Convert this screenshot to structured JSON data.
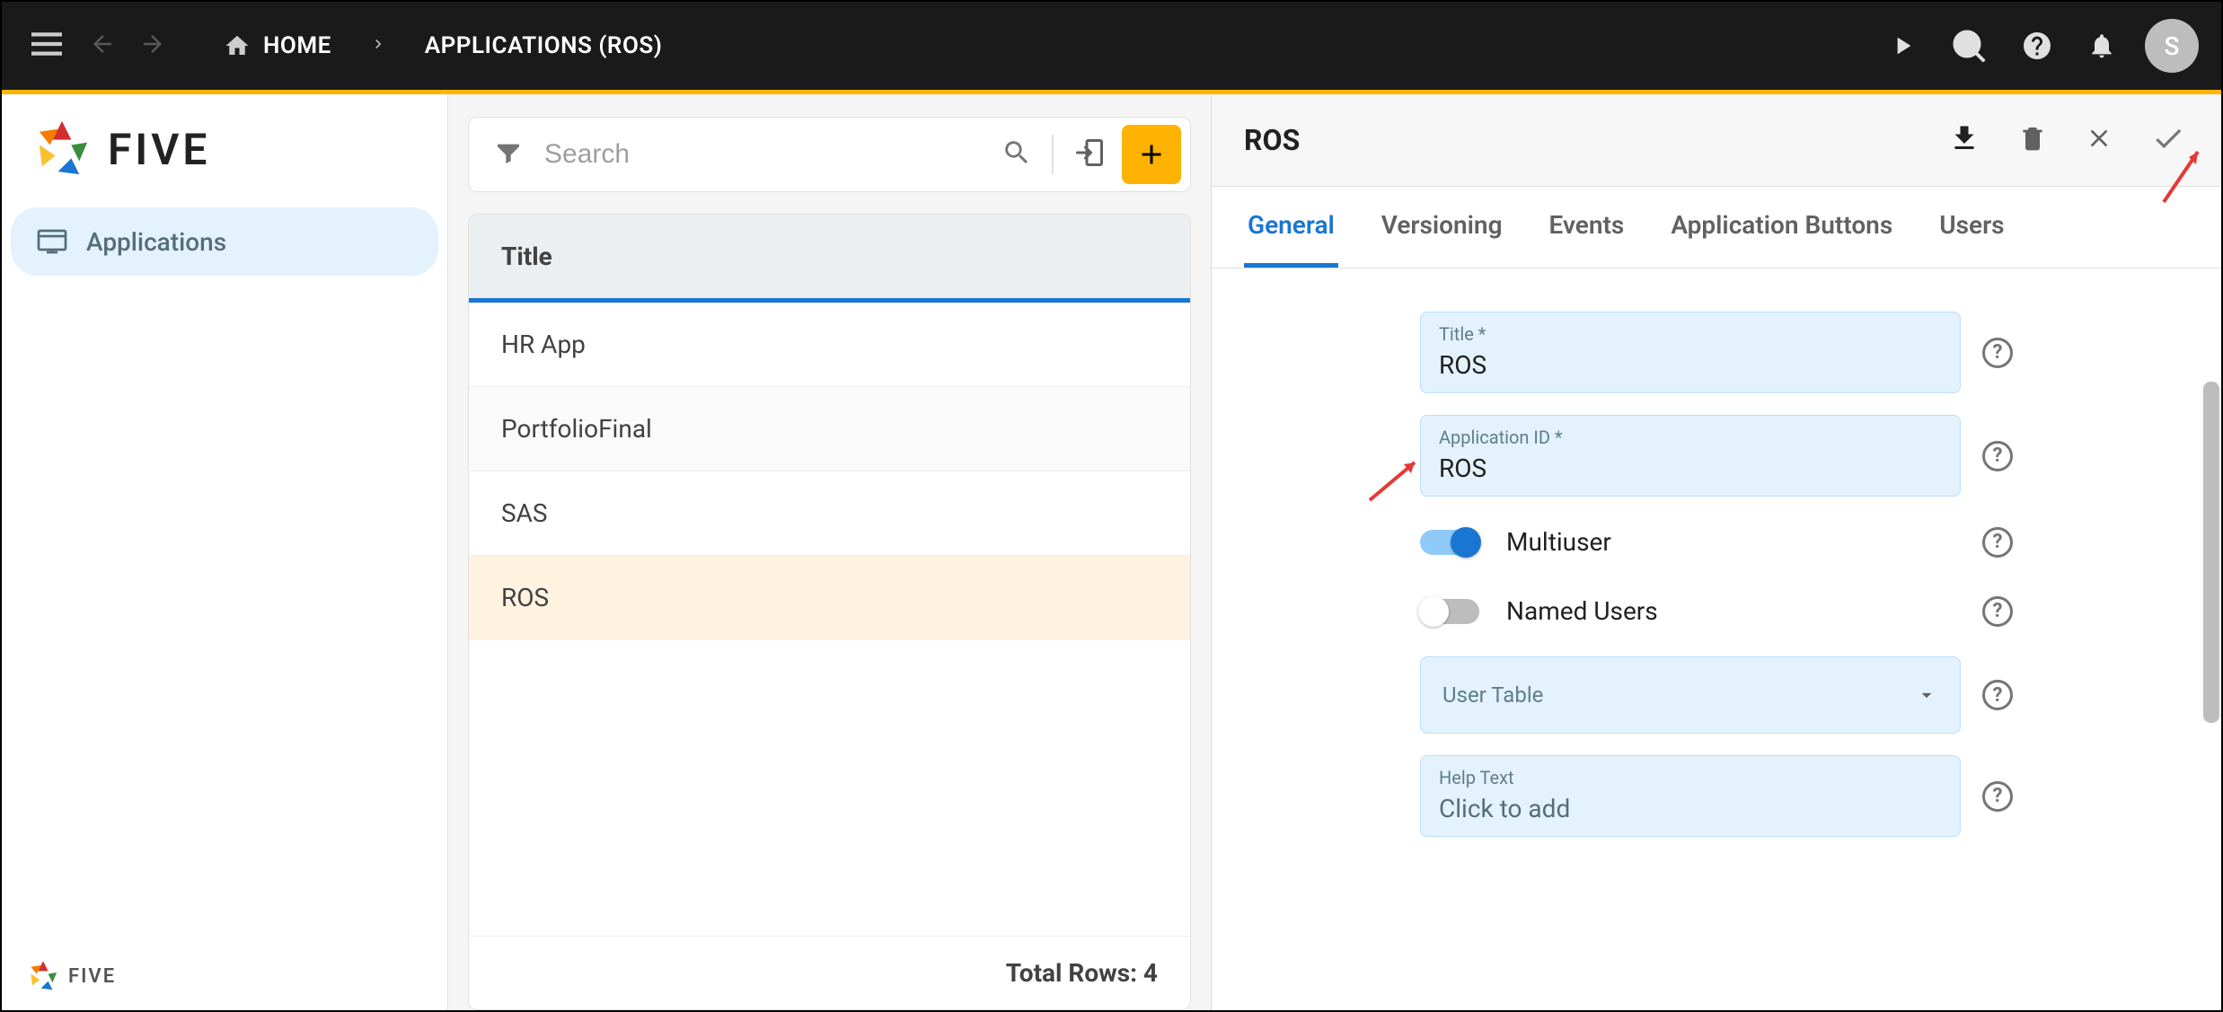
{
  "topbar": {
    "breadcrumbs": [
      {
        "label": "HOME"
      },
      {
        "label": "APPLICATIONS (ROS)"
      }
    ],
    "avatar_initial": "S"
  },
  "sidebar": {
    "brand": "FIVE",
    "footer_brand": "FIVE",
    "items": [
      {
        "label": "Applications"
      }
    ]
  },
  "middle": {
    "search_placeholder": "Search",
    "list_header": "Title",
    "rows": [
      {
        "title": "HR App"
      },
      {
        "title": "PortfolioFinal"
      },
      {
        "title": "SAS"
      },
      {
        "title": "ROS"
      }
    ],
    "footer_label": "Total Rows: 4"
  },
  "detail": {
    "title": "ROS",
    "tabs": [
      {
        "label": "General"
      },
      {
        "label": "Versioning"
      },
      {
        "label": "Events"
      },
      {
        "label": "Application Buttons"
      },
      {
        "label": "Users"
      }
    ],
    "fields": {
      "title_label": "Title *",
      "title_value": "ROS",
      "appid_label": "Application ID *",
      "appid_value": "ROS",
      "multiuser_label": "Multiuser",
      "namedusers_label": "Named Users",
      "usertable_label": "User Table",
      "helptext_label": "Help Text",
      "helptext_value": "Click to add"
    }
  }
}
